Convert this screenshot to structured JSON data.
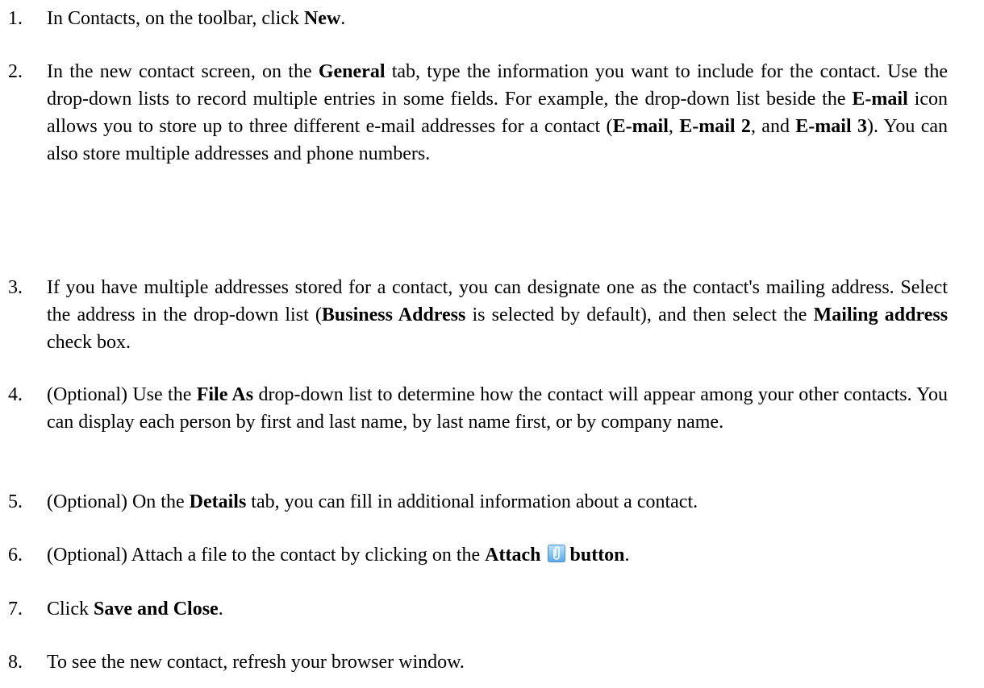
{
  "steps": [
    {
      "number": "1.",
      "parts": [
        "In Contacts, on the toolbar, click ",
        "New",
        "."
      ]
    },
    {
      "number": "2.",
      "parts": [
        "In the new contact screen, on the ",
        "General",
        " tab, type the information you want to include for the contact.  Use the drop-down lists to record multiple entries in some fields.  For example, the drop-down list beside the ",
        "E-mail",
        " icon allows you to store up to three different e-mail addresses for a contact (",
        "E-mail",
        ", ",
        "E-mail 2",
        ", and ",
        "E-mail 3",
        ").  You can also store multiple addresses and phone numbers."
      ]
    },
    {
      "number": "3.",
      "parts": [
        "If you have multiple addresses stored for a contact, you can designate one as the contact's mailing address.  Select the address in the drop-down list (",
        "Business Address",
        " is selected by default), and then select the ",
        "Mailing address",
        " check box."
      ]
    },
    {
      "number": "4.",
      "parts": [
        "(Optional) Use the ",
        "File As",
        " drop-down list to determine how the contact will appear among your other contacts. You can display each person by first and last name, by last name first, or by company name."
      ]
    },
    {
      "number": "5.",
      "parts": [
        "(Optional)  On the ",
        "Details",
        " tab, you can fill in additional information about a contact."
      ]
    },
    {
      "number": "6.",
      "parts": [
        "(Optional)  Attach a file to the contact by clicking on the ",
        "Attach",
        "button",
        "."
      ],
      "icon": "paperclip-icon"
    },
    {
      "number": "7.",
      "parts": [
        "Click ",
        "Save and Close",
        "."
      ]
    },
    {
      "number": "8.",
      "parts": [
        "To see the new contact, refresh your browser window."
      ]
    }
  ]
}
